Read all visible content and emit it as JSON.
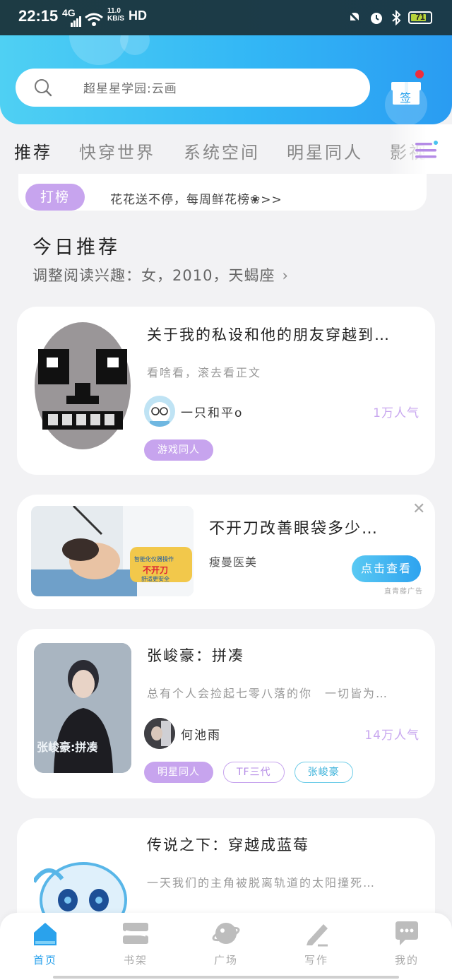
{
  "status_bar": {
    "time": "22:15",
    "network": "4G",
    "speed_value": "11.0",
    "speed_unit": "KB/S",
    "hd": "HD",
    "battery": "71"
  },
  "search": {
    "placeholder": "超星星学园:云画"
  },
  "checkin": {
    "label": "签"
  },
  "tabs": [
    {
      "label": "推荐",
      "active": true
    },
    {
      "label": "快穿世界"
    },
    {
      "label": "系统空间"
    },
    {
      "label": "明星同人"
    },
    {
      "label": "影视"
    }
  ],
  "rank_banner": {
    "tag": "打榜",
    "text": "花花送不停，每周鲜花榜❀>>"
  },
  "recommend": {
    "title": "今日推荐",
    "subtitle": "调整阅读兴趣：女，2010，天蝎座"
  },
  "books": [
    {
      "title": "关于我的私设和他的朋友穿越到…",
      "desc": "看啥看，滚去看正文",
      "author": "一只和平o",
      "popularity": "1万人气",
      "tags": [
        "游戏同人"
      ]
    },
    {
      "title": "张峻豪：拼凑",
      "desc": "总有个人会捡起七零八落的你　一切皆为…",
      "author": "何池雨",
      "popularity": "14万人气",
      "tags": [
        "明星同人",
        "TF三代",
        "张峻豪"
      ],
      "cover_text": "张峻豪:拼凑"
    },
    {
      "title": "传说之下：穿越成蓝莓",
      "desc": "一天我们的主角被脱离轨道的太阳撞死…"
    }
  ],
  "ad": {
    "title": "不开刀改善眼袋多少…",
    "brand": "瘦曼医美",
    "button": "点击查看",
    "label": "直青藤广告",
    "image_caption_1": "智能化仪器操作",
    "image_caption_2": "不开刀",
    "image_caption_3": "舒适更安全"
  },
  "bottom_nav": [
    {
      "label": "首页",
      "icon": "home-icon",
      "active": true
    },
    {
      "label": "书架",
      "icon": "bookshelf-icon"
    },
    {
      "label": "广场",
      "icon": "planet-icon"
    },
    {
      "label": "写作",
      "icon": "pen-icon"
    },
    {
      "label": "我的",
      "icon": "chat-bubble-icon"
    }
  ],
  "colors": {
    "header_start": "#4fd0f3",
    "header_end": "#2a9cf2",
    "accent_purple": "#c7a4ee",
    "accent_blue": "#2aa2ec"
  }
}
